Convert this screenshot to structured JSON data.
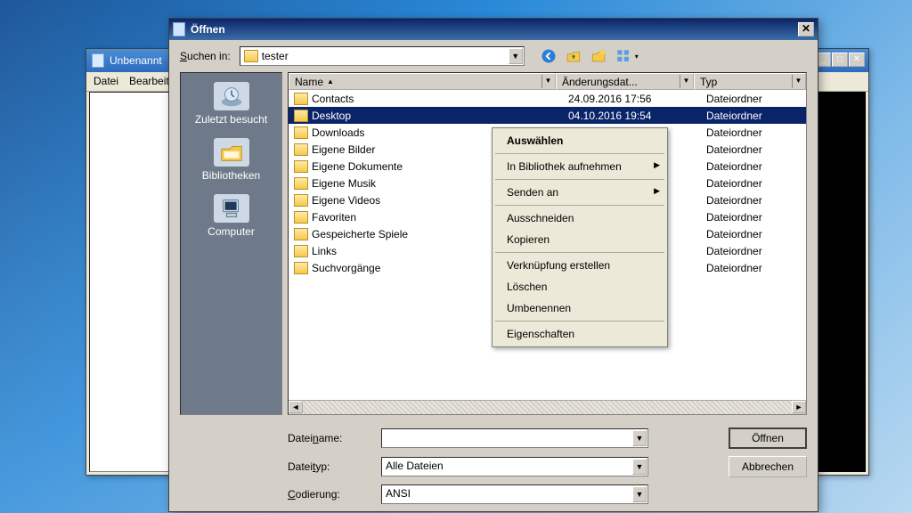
{
  "notepad": {
    "title": "Unbenannt",
    "menu": {
      "file": "Datei",
      "edit": "Bearbeiten"
    }
  },
  "dialog": {
    "title": "Öffnen",
    "search_in_label": "Suchen in:",
    "search_in_value": "tester",
    "places": {
      "recent": "Zuletzt besucht",
      "libraries": "Bibliotheken",
      "computer": "Computer"
    },
    "columns": {
      "name": "Name",
      "date": "Änderungsdat...",
      "type": "Typ"
    },
    "rows": [
      {
        "name": "Contacts",
        "date": "24.09.2016 17:56",
        "type": "Dateiordner",
        "sel": false
      },
      {
        "name": "Desktop",
        "date": "04.10.2016 19:54",
        "type": "Dateiordner",
        "sel": true
      },
      {
        "name": "Downloads",
        "date": "",
        "type": "Dateiordner",
        "sel": false
      },
      {
        "name": "Eigene Bilder",
        "date": "",
        "type": "Dateiordner",
        "sel": false
      },
      {
        "name": "Eigene Dokumente",
        "date": "",
        "type": "Dateiordner",
        "sel": false
      },
      {
        "name": "Eigene Musik",
        "date": "",
        "type": "Dateiordner",
        "sel": false
      },
      {
        "name": "Eigene Videos",
        "date": "",
        "type": "Dateiordner",
        "sel": false
      },
      {
        "name": "Favoriten",
        "date": "",
        "type": "Dateiordner",
        "sel": false
      },
      {
        "name": "Gespeicherte Spiele",
        "date": "",
        "type": "Dateiordner",
        "sel": false
      },
      {
        "name": "Links",
        "date": "",
        "type": "Dateiordner",
        "sel": false
      },
      {
        "name": "Suchvorgänge",
        "date": "",
        "type": "Dateiordner",
        "sel": false
      }
    ],
    "context_menu": {
      "select": "Auswählen",
      "include_library": "In Bibliothek aufnehmen",
      "send_to": "Senden an",
      "cut": "Ausschneiden",
      "copy": "Kopieren",
      "shortcut": "Verknüpfung erstellen",
      "delete": "Löschen",
      "rename": "Umbenennen",
      "properties": "Eigenschaften"
    },
    "filename_label": "Dateiname:",
    "filename_value": "",
    "filetype_label": "Dateityp:",
    "filetype_value": "Alle Dateien",
    "encoding_label": "Codierung:",
    "encoding_value": "ANSI",
    "open_btn": "Öffnen",
    "cancel_btn": "Abbrechen"
  }
}
